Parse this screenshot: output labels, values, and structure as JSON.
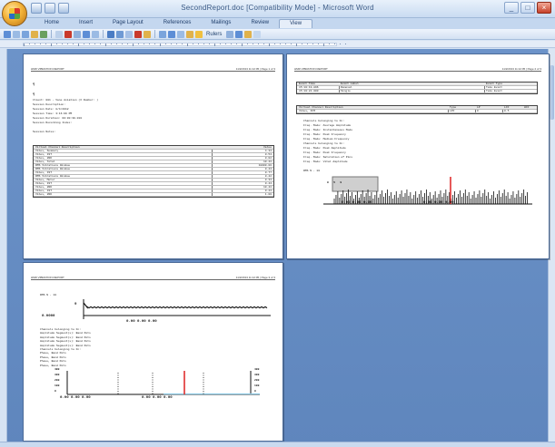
{
  "window": {
    "title": "SecondReport.doc [Compatibility Mode] - Microsoft Word",
    "controls": [
      "_",
      "□",
      "×"
    ]
  },
  "ribbon": {
    "tabs": [
      "Home",
      "Insert",
      "Page Layout",
      "References",
      "Mailings",
      "Review",
      "View"
    ],
    "active_tab": "View"
  },
  "toolbar": {
    "zoom_label": "Rulers"
  },
  "page1": {
    "header_left": "HMR VIBRATION REPORT",
    "header_right": "11/2/2013 11:12:05 | Page 1 of 3",
    "lines": [
      "Client: 001 - Vane Aviation (X Number: )",
      "Session Description:",
      "Session Date: 8/4/2012",
      "Session Time: 3:16:09 PM",
      "Session Duration: 00:00:30.010",
      "Session Recording Index:",
      "",
      "Session Notes:"
    ],
    "table_header": [
      "Virtual Channel Description",
      "Value"
    ],
    "table_rows": [
      [
        "Vibes, Summary",
        "4.34"
      ],
      [
        "Vibes, 1ST",
        "0.54"
      ],
      [
        "Vibes, 2ND",
        "0.02"
      ],
      [
        "Vibes, Total",
        "10.44"
      ],
      [
        "RMS Vibrations Window",
        "18000.00"
      ],
      [
        "RMS Vibrations Window",
        "0.44"
      ],
      [
        "Vibes, 1ST",
        "0.77"
      ],
      [
        "RMS Vibrations Window",
        "0.42"
      ],
      [
        "Vibes, Motor",
        "0.34"
      ],
      [
        "Vibes, 1ST",
        "0.44"
      ],
      [
        "Vibes, 2ND",
        "10.44"
      ],
      [
        "Vibes, 1ST",
        "0.44"
      ],
      [
        "Vibes, 2ND",
        "1.00"
      ]
    ]
  },
  "page2": {
    "header_left": "HMR VIBRATION REPORT",
    "header_right": "11/2/2013 11:12:05 | Page 2 of 3",
    "event_header": [
      "Event Time",
      "Event Label",
      "Event Type"
    ],
    "event_rows": [
      [
        "15:10:19.896",
        "Removal",
        "Take Event"
      ],
      [
        "15:10:22.000",
        "Single",
        "Take Event"
      ]
    ],
    "channel_header": [
      "Virtual Channel Description",
      "Type",
      "LP",
      "LCF",
      "HCF"
    ],
    "channel_rows": [
      [
        "Vibes, FFM",
        "LPF",
        "0",
        "0.5",
        ""
      ]
    ],
    "notes": [
      "Channels belonging to Fn:",
      "   Freq. Mode: Average Amplitude",
      "   Freq. Mode: Instantaneous Mode",
      "   Freq. Mode: Peak Frequency",
      "   Freq. Mode: Medium Frequency",
      "Channels belonging to Fn:",
      "   Freq. Mode: Peak Amplitude",
      "   Freq. Mode: Peak Frequency",
      "   Freq. Mode: Saturation of Pins",
      "   Freq. Mode: Vital Amplitude"
    ],
    "plot_title": "RMS N - 10",
    "plot_axis_left": "0   5   9",
    "plot_x_labels": [
      "0.00",
      "0.00",
      "0.00",
      "0.00",
      "0.00",
      "0.00"
    ]
  },
  "page3": {
    "header_left": "HMR VIBRATION REPORT",
    "header_right": "11/2/2013 11:12:05 | Page 3 of 3",
    "plot_title": "RMS N - 10",
    "plot_y_top": "9",
    "plot_y_bottom": "0.0000",
    "plot_x_labels": [
      "0.00",
      "0.00",
      "0.00"
    ],
    "notes": [
      "Channels belonging to Fn:",
      "   Amplitude Segment(s): Band Pots",
      "   Amplitude Segment(s): Band Pots",
      "   Amplitude Segment(s): Band Pots",
      "   Amplitude Segment(s): Band Pots",
      "Channels belonging to Fn:",
      "   Phase, Band Pots",
      "   Phase, Band Pots",
      "   Phase, Band Pots",
      "   Phase, Band Pots"
    ],
    "spectrum_y_left": [
      "400",
      "300",
      "200",
      "100",
      "0"
    ],
    "spectrum_y_right": [
      "400",
      "300",
      "200",
      "100",
      "0"
    ],
    "spectrum_x_left": [
      "0.00",
      "0.00",
      "0.00"
    ],
    "spectrum_x_right": [
      "0.00",
      "0.00",
      "0.00"
    ]
  },
  "colors": {
    "doc_background": "#6289bf",
    "highlight": "#e03030",
    "ribbon": "#c4d7ef"
  }
}
